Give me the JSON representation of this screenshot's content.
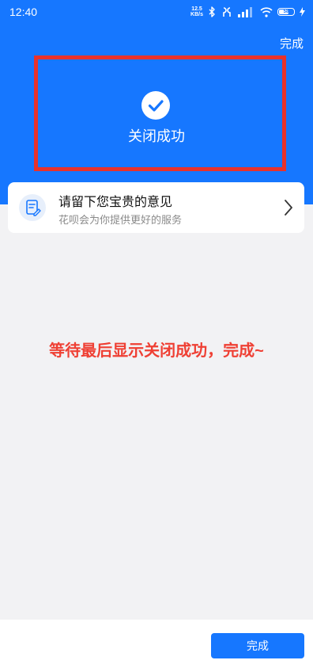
{
  "status_bar": {
    "time": "12:40",
    "net_speed_value": "12.5",
    "net_speed_unit": "KB/s",
    "battery_level": "58"
  },
  "header": {
    "done_label": "完成"
  },
  "result": {
    "title": "关闭成功",
    "icon": "check-circle-icon"
  },
  "feedback": {
    "title": "请留下您宝贵的意见",
    "subtitle": "花呗会为你提供更好的服务",
    "icon": "edit-document-icon"
  },
  "annotation": {
    "text": "等待最后显示关闭成功，完成~",
    "color": "#ef4034"
  },
  "footer": {
    "done_label": "完成"
  },
  "colors": {
    "brand_blue": "#1677ff",
    "highlight_red": "#e8322b",
    "page_bg": "#f2f2f4"
  }
}
